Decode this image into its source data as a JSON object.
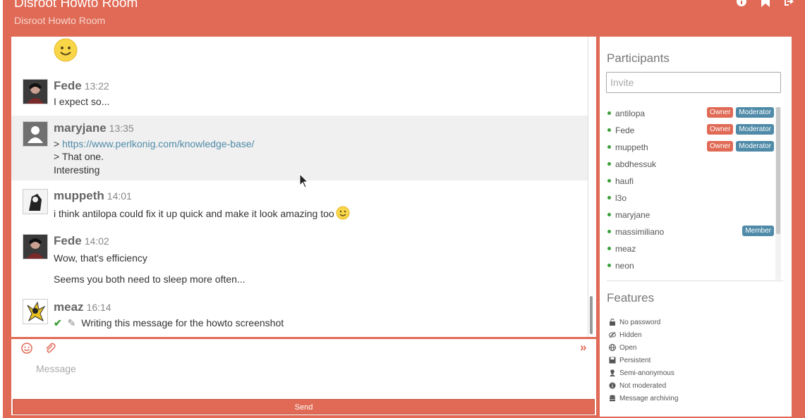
{
  "header": {
    "title": "Disroot Howto Room",
    "subtitle": "Disroot Howto Room",
    "icons": [
      "info-icon",
      "bookmark-icon",
      "sign-out-icon"
    ]
  },
  "messages": [
    {
      "nick": "Fede",
      "time": "13:22",
      "lines": [
        "I expect so..."
      ]
    },
    {
      "nick": "maryjane",
      "time": "13:35",
      "quote_prefix": "> ",
      "link": "https://www.perlkonig.com/knowledge-base/",
      "lines": [
        "> That one.",
        "Interesting"
      ]
    },
    {
      "nick": "muppeth",
      "time": "14:01",
      "lines": [
        "i think antilopa could fix it up quick and make it look amazing too"
      ]
    },
    {
      "nick": "Fede",
      "time": "14:02",
      "lines": [
        "Wow, that's efficiency",
        "Seems you both need to sleep more often..."
      ]
    },
    {
      "nick": "meaz",
      "time": "16:14",
      "lines": [
        "Writing this message for the howto screenshot"
      ]
    }
  ],
  "compose": {
    "placeholder": "Message",
    "send_label": "Send"
  },
  "participants": {
    "heading": "Participants",
    "invite_placeholder": "Invite",
    "owner_label": "Owner",
    "moderator_label": "Moderator",
    "member_label": "Member",
    "list": [
      {
        "name": "antilopa",
        "roles": [
          "Owner",
          "Moderator"
        ]
      },
      {
        "name": "Fede",
        "roles": [
          "Owner",
          "Moderator"
        ]
      },
      {
        "name": "muppeth",
        "roles": [
          "Owner",
          "Moderator"
        ]
      },
      {
        "name": "abdhessuk",
        "roles": []
      },
      {
        "name": "haufi",
        "roles": []
      },
      {
        "name": "l3o",
        "roles": []
      },
      {
        "name": "maryjane",
        "roles": []
      },
      {
        "name": "massimiliano",
        "roles": [
          "Member"
        ]
      },
      {
        "name": "meaz",
        "roles": []
      },
      {
        "name": "neon",
        "roles": []
      }
    ]
  },
  "features": {
    "heading": "Features",
    "items": [
      {
        "icon": "lock-open-icon",
        "label": "No password"
      },
      {
        "icon": "eye-slash-icon",
        "label": "Hidden"
      },
      {
        "icon": "globe-icon",
        "label": "Open"
      },
      {
        "icon": "save-icon",
        "label": "Persistent"
      },
      {
        "icon": "user-secret-icon",
        "label": "Semi-anonymous"
      },
      {
        "icon": "info-circle-icon",
        "label": "Not moderated"
      },
      {
        "icon": "database-icon",
        "label": "Message archiving"
      }
    ]
  },
  "colors": {
    "accent": "#e06a55",
    "badge_blue": "#4f8ba8",
    "online": "#3c9f3c"
  }
}
